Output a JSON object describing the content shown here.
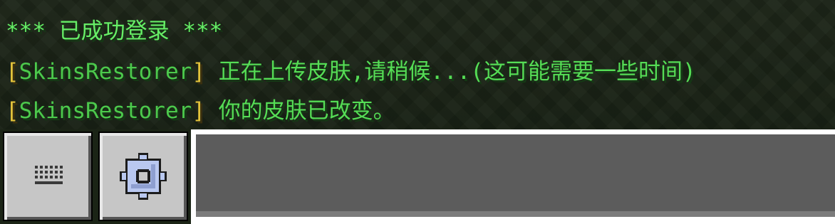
{
  "chat": {
    "line1": "*** 已成功登录 ***",
    "line2": {
      "bracket_open": "[",
      "plugin": "SkinsRestorer",
      "bracket_close": "]",
      "message": " 正在上传皮肤,请稍候...(这可能需要一些时间)"
    },
    "line3": {
      "bracket_open": "[",
      "plugin": "SkinsRestorer",
      "bracket_close": "]",
      "message": " 你的皮肤已改变。"
    }
  },
  "controls": {
    "keyboard_icon": "keyboard-icon",
    "settings_icon": "gear-icon"
  },
  "colors": {
    "chat_green": "#55dd55",
    "plugin_bracket": "#e2c23a",
    "button_gray": "#c6c6c6",
    "input_gray": "#5c5c5c"
  }
}
